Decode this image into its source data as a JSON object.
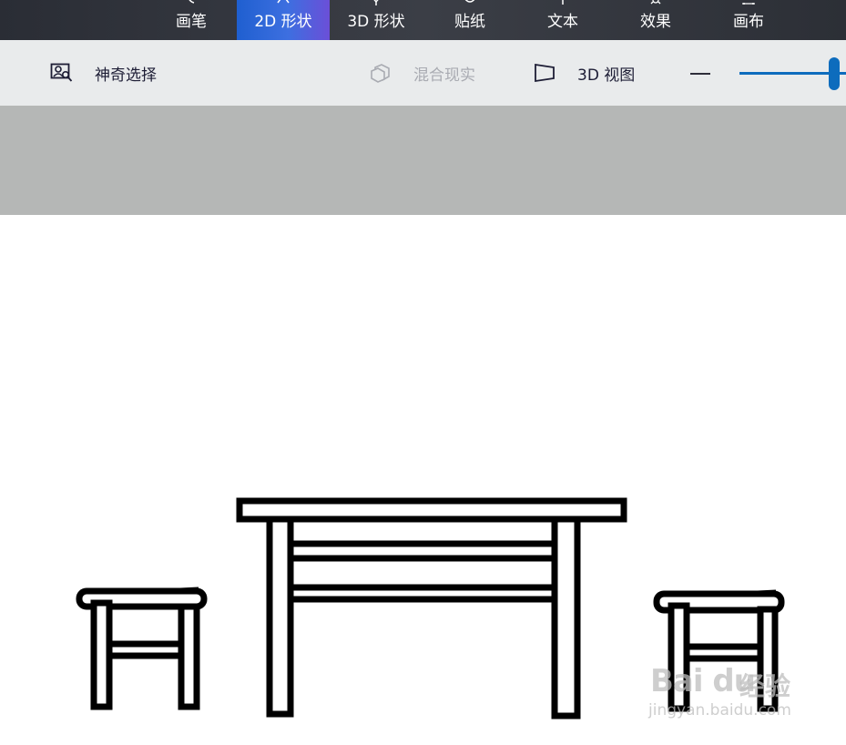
{
  "tabs": [
    {
      "label": "画笔",
      "icon": "brush-icon"
    },
    {
      "label": "2D 形状",
      "icon": "2d-shapes-icon",
      "active": true
    },
    {
      "label": "3D 形状",
      "icon": "3d-shapes-icon"
    },
    {
      "label": "贴纸",
      "icon": "sticker-icon"
    },
    {
      "label": "文本",
      "icon": "text-icon"
    },
    {
      "label": "效果",
      "icon": "effects-icon"
    },
    {
      "label": "画布",
      "icon": "canvas-icon"
    }
  ],
  "toolbar": {
    "magic_select": "神奇选择",
    "mixed_reality": "混合现实",
    "view_3d": "3D 视图"
  },
  "watermark": {
    "brand": "Bai du",
    "brand_cn": "经验",
    "url": "jingyan.baidu.com"
  },
  "colors": {
    "accent": "#0d6cbd",
    "active_tab_start": "#1f5fd0",
    "active_tab_end": "#6b4fd8",
    "topbar": "#2f3239",
    "toolbar": "#e9ebec",
    "canvas_strip": "#b5b7b6"
  }
}
